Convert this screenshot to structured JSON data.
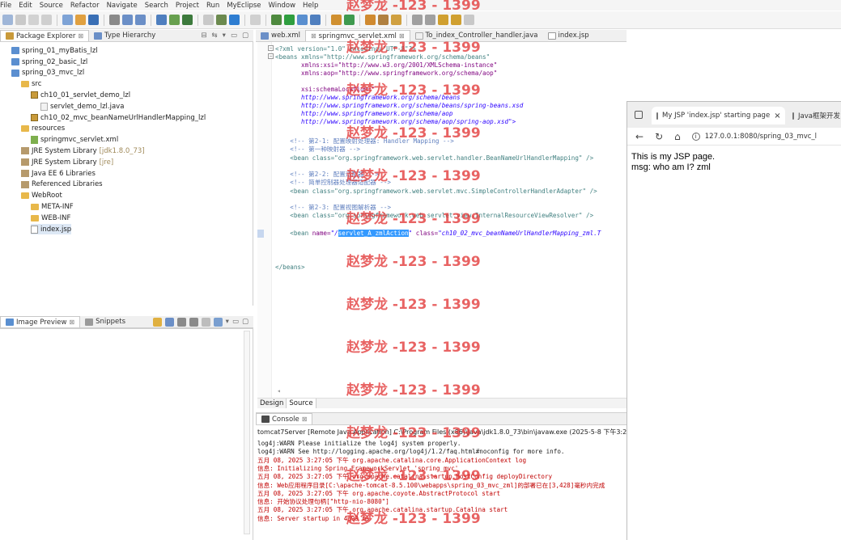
{
  "menu": [
    "File",
    "Edit",
    "Source",
    "Refactor",
    "Navigate",
    "Search",
    "Project",
    "Run",
    "MyEclipse",
    "Window",
    "Help"
  ],
  "explorer": {
    "tabs": [
      "Package Explorer",
      "Type Hierarchy"
    ],
    "tree": [
      {
        "label": "spring_01_myBatis_lzl",
        "icon": "project-icon",
        "deco": ""
      },
      {
        "label": "spring_02_basic_lzl",
        "icon": "project-icon",
        "deco": ""
      },
      {
        "label": "spring_03_mvc_lzl",
        "icon": "project-icon",
        "deco": ""
      },
      {
        "label": "src",
        "icon": "source-folder-icon",
        "deco": ""
      },
      {
        "label": "ch10_01_servlet_demo_lzl",
        "icon": "package-icon",
        "deco": ""
      },
      {
        "label": "servlet_demo_lzl.java",
        "icon": "java-file-icon",
        "deco": ""
      },
      {
        "label": "ch10_02_mvc_beanNameUrlHandlerMapping_lzl",
        "icon": "package-icon",
        "deco": ""
      },
      {
        "label": "resources",
        "icon": "source-folder-icon",
        "deco": ""
      },
      {
        "label": "springmvc_servlet.xml",
        "icon": "xml-file-icon",
        "deco": ""
      },
      {
        "label": "JRE System Library",
        "icon": "library-icon",
        "deco": "[jdk1.8.0_73]"
      },
      {
        "label": "JRE System Library",
        "icon": "library-icon",
        "deco": "[jre]"
      },
      {
        "label": "Java EE 6 Libraries",
        "icon": "library-icon",
        "deco": ""
      },
      {
        "label": "Referenced Libraries",
        "icon": "library-icon",
        "deco": ""
      },
      {
        "label": "WebRoot",
        "icon": "folder-icon",
        "deco": ""
      },
      {
        "label": "META-INF",
        "icon": "folder-icon",
        "deco": ""
      },
      {
        "label": "WEB-INF",
        "icon": "folder-icon",
        "deco": ""
      },
      {
        "label": "index.jsp",
        "icon": "jsp-file-icon",
        "deco": ""
      }
    ]
  },
  "preview": {
    "tabs": [
      "Image Preview",
      "Snippets"
    ]
  },
  "editor": {
    "tabs": [
      "web.xml",
      "springmvc_servlet.xml",
      "To_index_Controller_handler.java",
      "index.jsp"
    ],
    "lines": [
      "<?xml version=\"1.0\" encoding=\"UTF-8\"?>",
      "<beans xmlns=\"http://www.springframework.org/schema/beans\"",
      "       xmlns:xsi=\"http://www.w3.org/2001/XMLSchema-instance\"",
      "       xmlns:aop=\"http://www.springframework.org/schema/aop\"",
      "",
      "       xsi:schemaLocation=\"",
      "       http://www.springframework.org/schema/beans",
      "       http://www.springframework.org/schema/beans/spring-beans.xsd",
      "       http://www.springframework.org/schema/aop",
      "       http://www.springframework.org/schema/aop/spring-aop.xsd\">",
      "",
      "    <!-- 第2-1: 配置映射处理器: Handler Mapping -->",
      "    <!-- 第一种映射器 -->",
      "    <bean class=\"org.springframework.web.servlet.handler.BeanNameUrlHandlerMapping\" />",
      "",
      "    <!-- 第2-2: 配置适配器 -->",
      "    <!-- 简单控制器处理器适配器 -->",
      "    <bean class=\"org.springframework.web.servlet.mvc.SimpleControllerHandlerAdapter\" />",
      "",
      "    <!-- 第2-3: 配置视图解析器 -->",
      "    <bean class=\"org.springframework.web.servlet.view.InternalResourceViewResolver\" />",
      "",
      "",
      "    <bean name=\"/servlet_A_zmlAction\" class=\"ch10_02_mvc_beanNameUrlHandlerMapping_zml.T",
      "",
      "",
      "",
      "</beans>"
    ],
    "highlight": "servlet_A_zmlAction",
    "bottom_tabs": [
      "Design",
      "Source"
    ]
  },
  "console": {
    "title": "Console",
    "description": "tomcat7Server [Remote Java Application] C:\\Program Files (x86)\\Java\\jdk1.8.0_73\\bin\\javaw.exe (2025-5-8 下午3:2",
    "lines": [
      {
        "text": "log4j:WARN Please initialize the log4j system properly.",
        "error": false
      },
      {
        "text": "log4j:WARN See http://logging.apache.org/log4j/1.2/faq.html#noconfig for more info.",
        "error": false
      },
      {
        "text": "五月 08, 2025 3:27:05 下午 org.apache.catalina.core.ApplicationContext log",
        "error": true
      },
      {
        "text": "信息: Initializing Spring FrameworkServlet 'spring_mvc'",
        "error": true
      },
      {
        "text": "五月 08, 2025 3:27:05 下午 org.apache.catalina.startup.HostConfig deployDirectory",
        "error": true
      },
      {
        "text": "信息: Web应用程序目录[C:\\apache-tomcat-8.5.100\\webapps\\spring_03_mvc_zml]的部署已在[3,428]毫秒内完成",
        "error": true
      },
      {
        "text": "五月 08, 2025 3:27:05 下午 org.apache.coyote.AbstractProtocol start",
        "error": true
      },
      {
        "text": "信息: 开始协议处理句柄[\"http-nio-8080\"]",
        "error": true
      },
      {
        "text": "五月 08, 2025 3:27:05 下午 org.apache.catalina.startup.Catalina start",
        "error": true
      },
      {
        "text": "信息: Server startup in 4399 ms",
        "error": true
      }
    ]
  },
  "browser": {
    "tabs": [
      "My JSP 'index.jsp' starting page",
      "Java框架开发"
    ],
    "url": "127.0.0.1:8080/spring_03_mvc_l",
    "content": [
      "This is my JSP page.",
      "msg: who am I? zml"
    ]
  },
  "watermark": "赵梦龙 -123 - 1399"
}
